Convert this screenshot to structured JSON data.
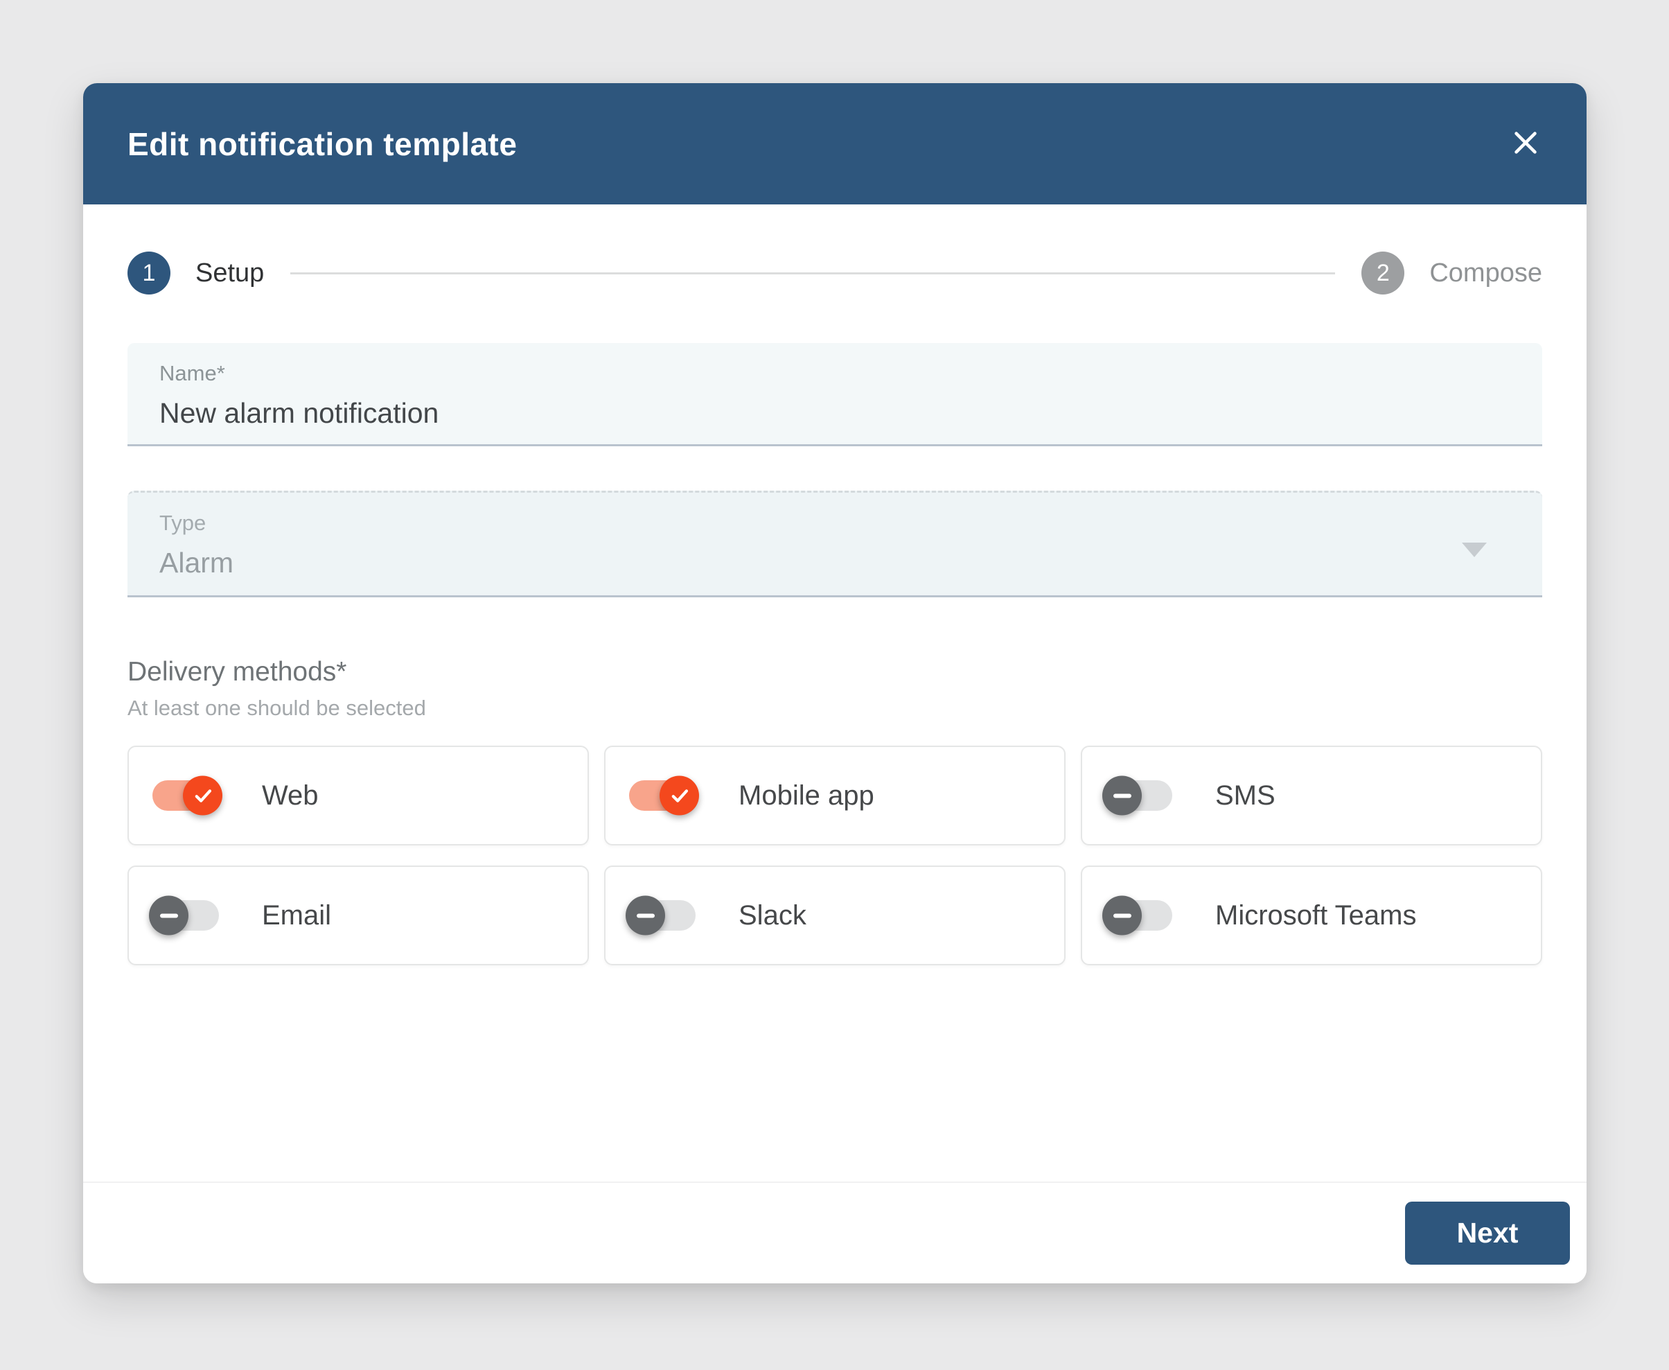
{
  "dialog": {
    "title": "Edit notification template"
  },
  "stepper": {
    "steps": [
      {
        "number": "1",
        "label": "Setup",
        "active": true
      },
      {
        "number": "2",
        "label": "Compose",
        "active": false
      }
    ]
  },
  "form": {
    "name_field": {
      "label": "Name*",
      "value": "New alarm notification"
    },
    "type_field": {
      "label": "Type",
      "value": "Alarm",
      "disabled": true
    }
  },
  "delivery": {
    "label": "Delivery methods*",
    "helper": "At least one should be selected",
    "methods": [
      {
        "label": "Web",
        "enabled": true
      },
      {
        "label": "Mobile app",
        "enabled": true
      },
      {
        "label": "SMS",
        "enabled": false
      },
      {
        "label": "Email",
        "enabled": false
      },
      {
        "label": "Slack",
        "enabled": false
      },
      {
        "label": "Microsoft Teams",
        "enabled": false
      }
    ]
  },
  "footer": {
    "next_label": "Next"
  },
  "colors": {
    "header_bg": "#2e567d",
    "accent_blue": "#2e567d",
    "toggle_on_knob": "#f4481d",
    "toggle_on_track": "#f8a48b",
    "toggle_off_knob": "#64676a",
    "toggle_off_track": "#e1e2e3"
  }
}
